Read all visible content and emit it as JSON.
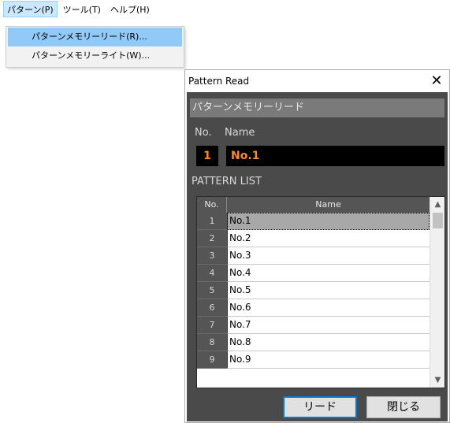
{
  "menubar": {
    "items": [
      {
        "label": "パターン(P)"
      },
      {
        "label": "ツール(T)"
      },
      {
        "label": "ヘルプ(H)"
      }
    ]
  },
  "dropdown": {
    "items": [
      {
        "label": "パターンメモリーリード(R)..."
      },
      {
        "label": "パターンメモリーライト(W)..."
      }
    ]
  },
  "dialog": {
    "title": "Pattern Read",
    "close_glyph": "✕",
    "header": "パターンメモリーリード",
    "no_label": "No.",
    "name_label": "Name",
    "current_no": "1",
    "current_name": "No.1",
    "list_label": "PATTERN LIST",
    "list": {
      "col_no": "No.",
      "col_name": "Name",
      "rows": [
        {
          "no": "1",
          "name": "No.1"
        },
        {
          "no": "2",
          "name": "No.2"
        },
        {
          "no": "3",
          "name": "No.3"
        },
        {
          "no": "4",
          "name": "No.4"
        },
        {
          "no": "5",
          "name": "No.5"
        },
        {
          "no": "6",
          "name": "No.6"
        },
        {
          "no": "7",
          "name": "No.7"
        },
        {
          "no": "8",
          "name": "No.8"
        },
        {
          "no": "9",
          "name": "No.9"
        }
      ],
      "selected_index": 0
    },
    "scroll_up_glyph": "▲",
    "scroll_down_glyph": "▼",
    "read_button": "リード",
    "close_button": "閉じる"
  },
  "colors": {
    "accent": "#0078d7",
    "highlight": "#91c9f7",
    "panel_bg": "#4a4a4a",
    "orange_text": "#ff8a1e"
  }
}
